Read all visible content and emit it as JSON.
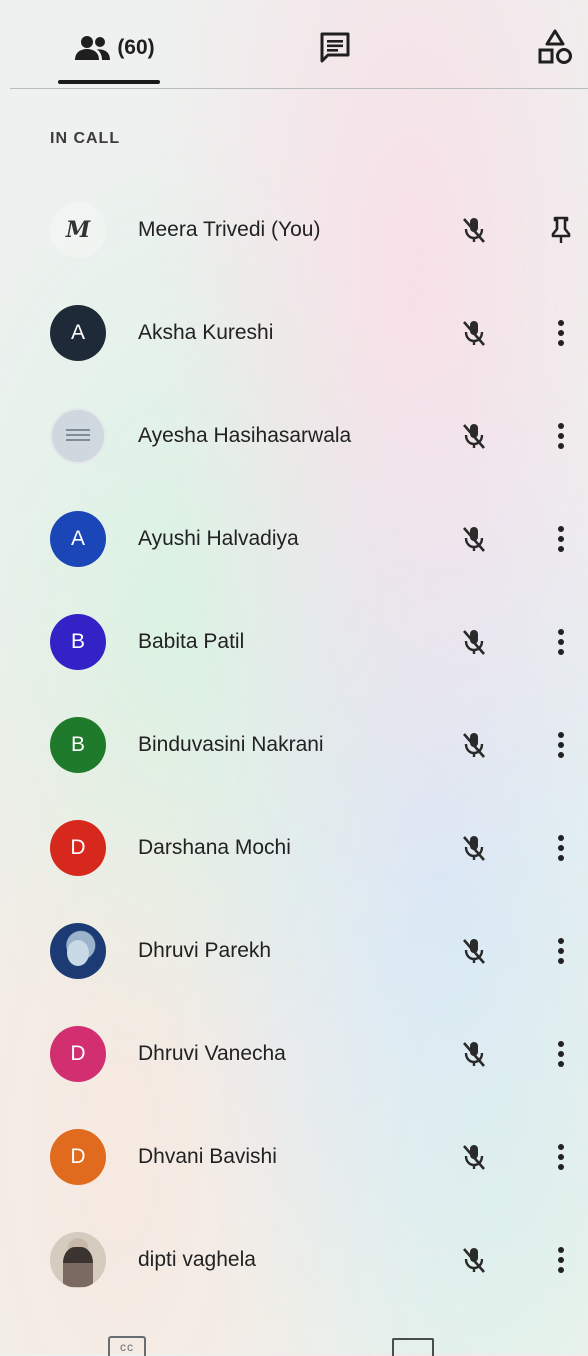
{
  "tabs": {
    "participant_count": "(60)"
  },
  "section_heading": "IN CALL",
  "participants": [
    {
      "name": "Meera Trivedi (You)",
      "avatar": "M",
      "avatar_type": "logo",
      "color": "#ffffff",
      "action_icon": "pin-icon"
    },
    {
      "name": "Aksha Kureshi",
      "avatar": "A",
      "avatar_type": "letter",
      "color": "#1e2a38",
      "action_icon": "more-vert-icon"
    },
    {
      "name": "Ayesha Hasihasarwala",
      "avatar": "",
      "avatar_type": "photo-org",
      "color": "#cfd8df",
      "action_icon": "more-vert-icon"
    },
    {
      "name": "Ayushi Halvadiya",
      "avatar": "A",
      "avatar_type": "letter",
      "color": "#1a46b8",
      "action_icon": "more-vert-icon"
    },
    {
      "name": "Babita Patil",
      "avatar": "B",
      "avatar_type": "letter",
      "color": "#3323c7",
      "action_icon": "more-vert-icon"
    },
    {
      "name": "Binduvasini Nakrani",
      "avatar": "B",
      "avatar_type": "letter",
      "color": "#1f7a2c",
      "action_icon": "more-vert-icon"
    },
    {
      "name": "Darshana Mochi",
      "avatar": "D",
      "avatar_type": "letter",
      "color": "#d7281e",
      "action_icon": "more-vert-icon"
    },
    {
      "name": "Dhruvi Parekh",
      "avatar": "",
      "avatar_type": "photo-person",
      "color": "#1c3a74",
      "action_icon": "more-vert-icon"
    },
    {
      "name": "Dhruvi Vanecha",
      "avatar": "D",
      "avatar_type": "letter",
      "color": "#d12f70",
      "action_icon": "more-vert-icon"
    },
    {
      "name": "Dhvani Bavishi",
      "avatar": "D",
      "avatar_type": "letter",
      "color": "#e06a1e",
      "action_icon": "more-vert-icon"
    },
    {
      "name": "dipti vaghela",
      "avatar": "",
      "avatar_type": "photo-girl",
      "color": "#d6cbbf",
      "action_icon": "more-vert-icon"
    }
  ],
  "bottom_bar": {
    "captions_label": "cc"
  },
  "icons": {
    "people_tab": "people-icon",
    "chat_tab": "chat-icon",
    "activities_tab": "activities-icon",
    "mic_state": "mic-off-icon"
  }
}
